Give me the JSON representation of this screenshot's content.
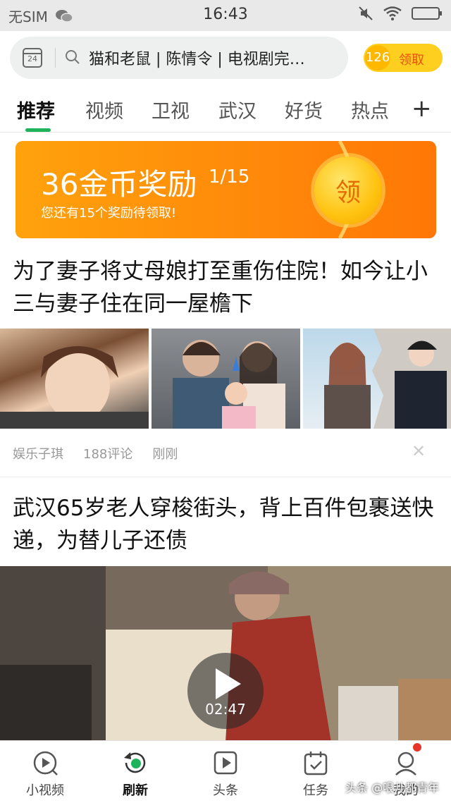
{
  "status_bar": {
    "carrier": "无SIM",
    "time": "16:43"
  },
  "header": {
    "search_query": "猫和老鼠 | 陈情令 | 电视剧完…",
    "coin_count": "126",
    "coin_claim_label": "领取",
    "calendar_day": "24"
  },
  "tabs": [
    {
      "label": "推荐",
      "active": true
    },
    {
      "label": "视频"
    },
    {
      "label": "卫视"
    },
    {
      "label": "武汉"
    },
    {
      "label": "好货"
    },
    {
      "label": "热点"
    }
  ],
  "banner": {
    "title": "36金币奖励",
    "progress": "1/15",
    "subtitle": "您还有15个奖励待领取!",
    "claim_label": "领"
  },
  "articles": [
    {
      "title": "为了妻子将丈母娘打至重伤住院！如今让小三与妻子住在同一屋檐下",
      "source": "娱乐子琪",
      "comments": "188评论",
      "time": "刚刚"
    },
    {
      "title": "武汉65岁老人穿梭街头，背上百件包裹送快递，为替儿子还债",
      "video_duration": "02:47"
    }
  ],
  "bottom_nav": [
    {
      "label": "小视频",
      "icon": "short-video-icon"
    },
    {
      "label": "刷新",
      "icon": "refresh-icon",
      "active": true
    },
    {
      "label": "头条",
      "icon": "headline-video-icon"
    },
    {
      "label": "任务",
      "icon": "task-calendar-icon"
    },
    {
      "label": "我的",
      "icon": "profile-icon"
    }
  ],
  "watermark": "头条 @哏儿都青年",
  "colors": {
    "accent_green": "#1eb35a",
    "banner_orange": "#ff8a0a",
    "coin_yellow": "#ffcf1f"
  }
}
